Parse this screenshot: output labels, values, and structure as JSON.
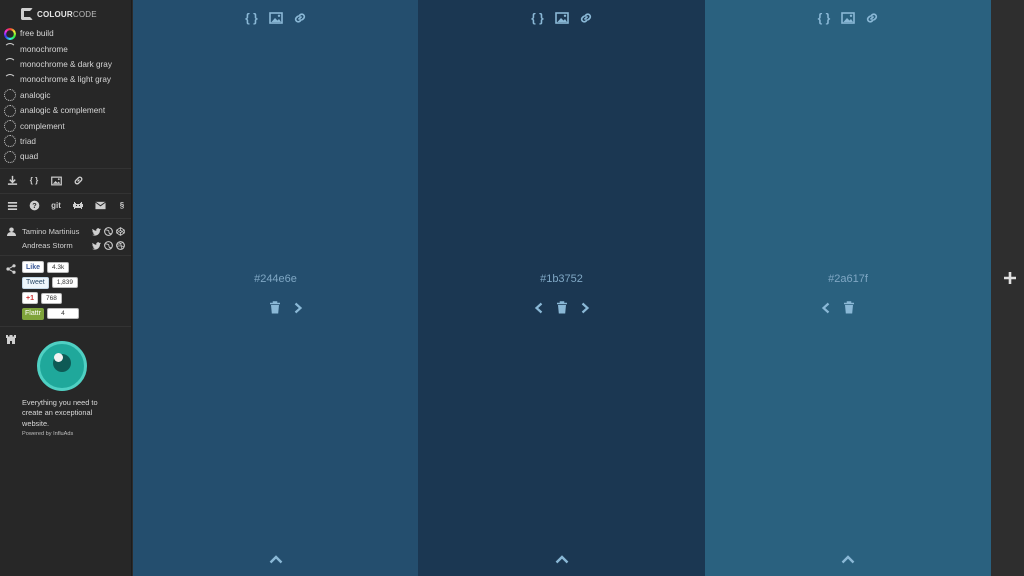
{
  "app": {
    "logo_bold": "COLOUR",
    "logo_light": "CODE"
  },
  "modes": [
    {
      "label": "free build",
      "icon": "color-wheel-icon"
    },
    {
      "label": "monochrome",
      "icon": "monochrome-icon"
    },
    {
      "label": "monochrome & dark gray",
      "icon": "monochrome-dark-icon"
    },
    {
      "label": "monochrome & light gray",
      "icon": "monochrome-light-icon"
    },
    {
      "label": "analogic",
      "icon": "analogic-icon"
    },
    {
      "label": "analogic & complement",
      "icon": "analogic-complement-icon"
    },
    {
      "label": "complement",
      "icon": "complement-icon"
    },
    {
      "label": "triad",
      "icon": "triad-icon"
    },
    {
      "label": "quad",
      "icon": "quad-icon"
    }
  ],
  "tools": {
    "code_label": "{ }"
  },
  "info": {
    "git_label": "git",
    "section_label": "§"
  },
  "people": [
    {
      "name": "Tamino Martinius"
    },
    {
      "name": "Andreas Storm"
    }
  ],
  "share": {
    "facebook": {
      "label": "Like",
      "count": "4.3k"
    },
    "twitter": {
      "label": "Tweet",
      "count": "1,839"
    },
    "gplus": {
      "label": "+1",
      "count": "768"
    },
    "flattr": {
      "label": "Flattr",
      "count": "4"
    }
  },
  "ad": {
    "text": "Everything you need to create an exceptional website.",
    "powered": "Powered by InfluAds"
  },
  "panels": [
    {
      "hex": "#244e6e",
      "color": "#244e6e",
      "code_label": "{ }"
    },
    {
      "hex": "#1b3752",
      "color": "#1b3752",
      "code_label": "{ }"
    },
    {
      "hex": "#2a617f",
      "color": "#2a617f",
      "code_label": "{ }"
    }
  ],
  "colors": {
    "sidebar_bg": "#272727",
    "icon_tint": "#8ab8d6",
    "add_bar_bg": "#2e2e2e"
  }
}
